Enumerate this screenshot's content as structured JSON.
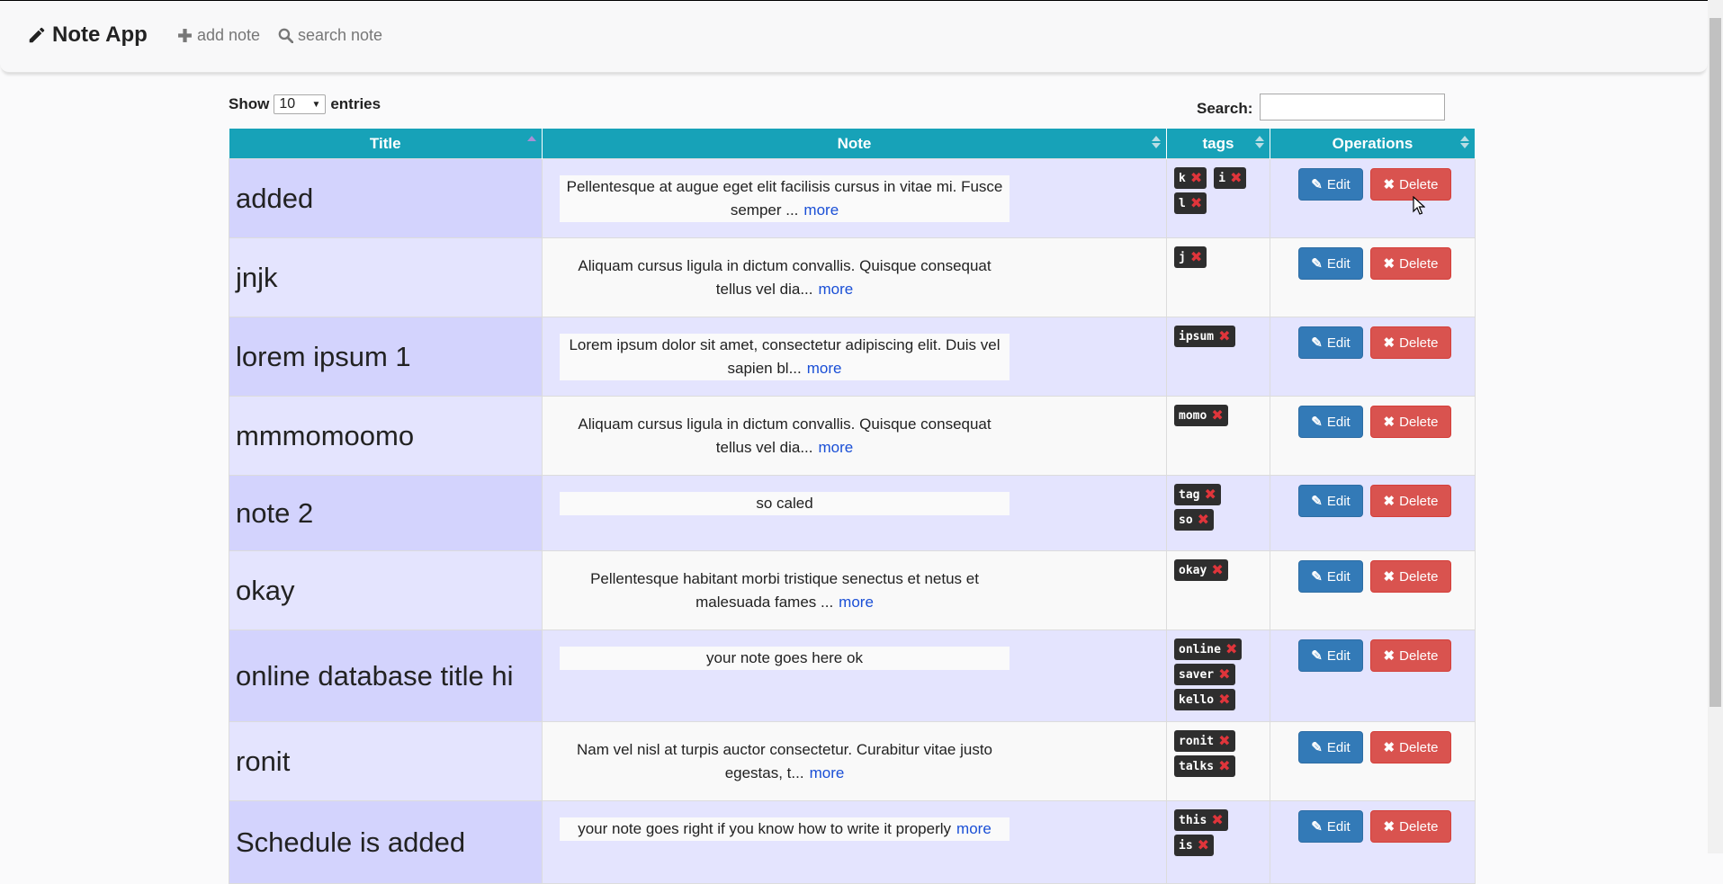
{
  "navbar": {
    "brand": "Note App",
    "add_note": "add note",
    "search_note": "search note"
  },
  "controls": {
    "show_label": "Show",
    "entries_value": "10",
    "entries_label": "entries",
    "search_label": "Search:",
    "search_value": ""
  },
  "table": {
    "headers": [
      "Title",
      "Note",
      "tags",
      "Operations"
    ],
    "edit_label": "Edit",
    "delete_label": "Delete",
    "more_label": "more",
    "rows": [
      {
        "title": "added",
        "note": "Pellentesque at augue eget elit facilisis cursus in vitae mi. Fusce semper ...",
        "has_more": true,
        "tags": [
          "k",
          "i",
          "l"
        ]
      },
      {
        "title": "jnjk",
        "note": "Aliquam cursus ligula in dictum convallis. Quisque consequat tellus vel dia...",
        "has_more": true,
        "tags": [
          "j"
        ]
      },
      {
        "title": "lorem ipsum 1",
        "note": "Lorem ipsum dolor sit amet, consectetur adipiscing elit. Duis vel sapien bl...",
        "has_more": true,
        "tags": [
          "ipsum"
        ]
      },
      {
        "title": "mmmomoomo",
        "note": "Aliquam cursus ligula in dictum convallis. Quisque consequat tellus vel dia...",
        "has_more": true,
        "tags": [
          "momo"
        ]
      },
      {
        "title": "note 2",
        "note": "so caled",
        "has_more": false,
        "tags": [
          "tag",
          "so"
        ]
      },
      {
        "title": "okay",
        "note": "Pellentesque habitant morbi tristique senectus et netus et malesuada fames ...",
        "has_more": true,
        "tags": [
          "okay"
        ]
      },
      {
        "title": "online database title hi",
        "note": "your note goes here ok",
        "has_more": false,
        "tags": [
          "online",
          "saver",
          "kello"
        ]
      },
      {
        "title": "ronit",
        "note": "Nam vel nisl at turpis auctor consectetur. Curabitur vitae justo egestas, t...",
        "has_more": true,
        "tags": [
          "ronit",
          "talks"
        ]
      },
      {
        "title": "Schedule is added",
        "note": "your note goes right if you know how to write it properly",
        "has_more": true,
        "tags": [
          "this",
          "is"
        ]
      }
    ]
  },
  "colors": {
    "header_bg": "#17a2b8",
    "edit_button": "#337ab7",
    "delete_button": "#d9534f",
    "tag_bg": "#2e2e2e",
    "tag_remove": "#e0353b",
    "more_link": "#1a4fd6"
  },
  "icons": {
    "brand": "pencil-icon",
    "add": "plus-icon",
    "search": "search-icon",
    "edit": "edit-icon",
    "delete": "times-icon",
    "tag_remove": "remove-tag-icon"
  }
}
